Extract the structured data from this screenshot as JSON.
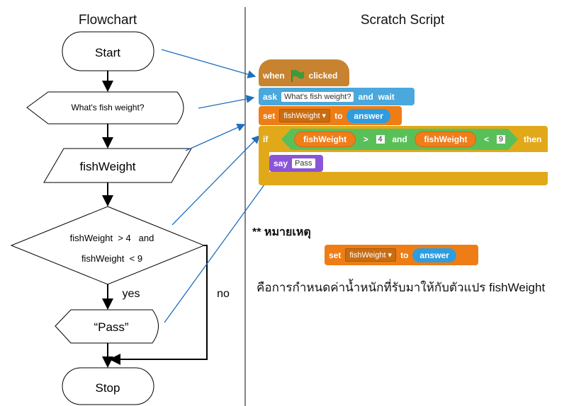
{
  "titles": {
    "flowchart": "Flowchart",
    "scratch": "Scratch Script"
  },
  "flowchart": {
    "start": "Start",
    "input": "What's fish weight?",
    "assign": "fishWeight",
    "decision_line1": "fishWeight  > 4   and",
    "decision_line2": "fishWeight  < 9",
    "yes": "yes",
    "no": "no",
    "output": "“Pass”",
    "stop": "Stop"
  },
  "scratch": {
    "hat": {
      "when": "when",
      "icon": "green-flag-icon",
      "clicked": "clicked"
    },
    "ask": {
      "keyword": "ask",
      "value": "What's fish weight?",
      "suffix": "and  wait"
    },
    "set": {
      "keyword": "set",
      "variable": "fishWeight",
      "to": "to",
      "value": "answer"
    },
    "if": {
      "keyword": "if",
      "left_var": "fishWeight",
      "op1": ">",
      "num1": "4",
      "and": "and",
      "right_var": "fishWeight",
      "op2": "<",
      "num2": "9",
      "then": "then"
    },
    "say": {
      "keyword": "say",
      "value": "Pass"
    }
  },
  "note": {
    "heading": "** หมายเหตุ",
    "set": {
      "keyword": "set",
      "variable": "fishWeight",
      "to": "to",
      "value": "answer"
    },
    "text": "คือการกำหนดค่าน้ำหนักที่รับมาให้กับตัวแปร fishWeight"
  },
  "colors": {
    "events": "#c88330",
    "sensing": "#5cb1d6",
    "data": "#ee7d16",
    "control": "#e1a91a",
    "operators": "#59c059",
    "looks": "#8a55d7",
    "arrow": "#1f6fbf"
  }
}
